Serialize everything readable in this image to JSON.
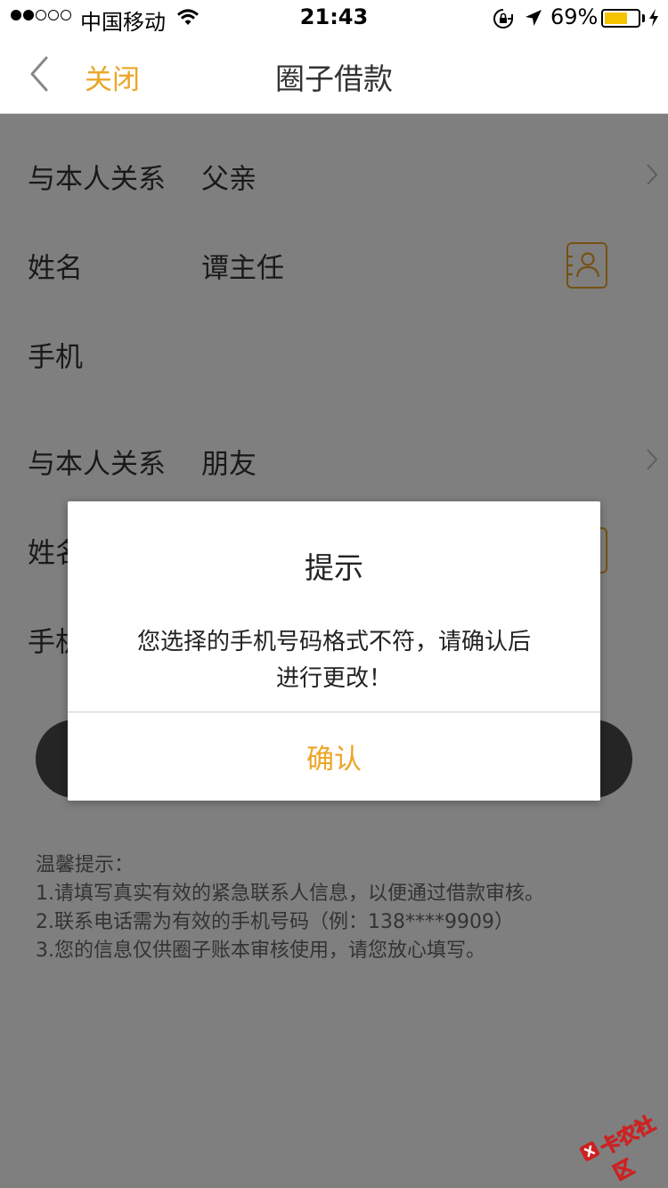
{
  "status_bar": {
    "carrier": "中国移动",
    "time": "21:43",
    "battery_percent": "69%",
    "battery_level": 0.69,
    "signal_strength": 2,
    "signal_max": 5,
    "icons": [
      "wifi-icon",
      "orientation-lock-icon",
      "location-arrow-icon",
      "battery-icon",
      "charging-bolt-icon"
    ]
  },
  "nav": {
    "back_icon": "chevron-left-icon",
    "close_label": "关闭",
    "title": "圈子借款"
  },
  "form": {
    "contact1": {
      "relation_label": "与本人关系",
      "relation_value": "父亲",
      "name_label": "姓名",
      "name_value": "谭主任",
      "phone_label": "手机"
    },
    "contact2": {
      "relation_label": "与本人关系",
      "relation_value": "朋友",
      "name_label": "姓名",
      "phone_label": "手机"
    }
  },
  "tips": {
    "heading": "温馨提示：",
    "lines": [
      "1.请填写真实有效的紧急联系人信息，以便通过借款审核。",
      "2.联系电话需为有效的手机号码（例：138****9909）",
      "3.您的信息仅供圈子账本审核使用，请您放心填写。"
    ]
  },
  "alert": {
    "title": "提示",
    "message_line1": "您选择的手机号码格式不符，请确认后",
    "message_line2": "进行更改！",
    "confirm_label": "确认"
  },
  "watermark": {
    "text": "卡农社区"
  },
  "colors": {
    "accent": "#eca526",
    "overlay": "rgba(0,0,0,0.5)",
    "battery": "#f5c400"
  }
}
